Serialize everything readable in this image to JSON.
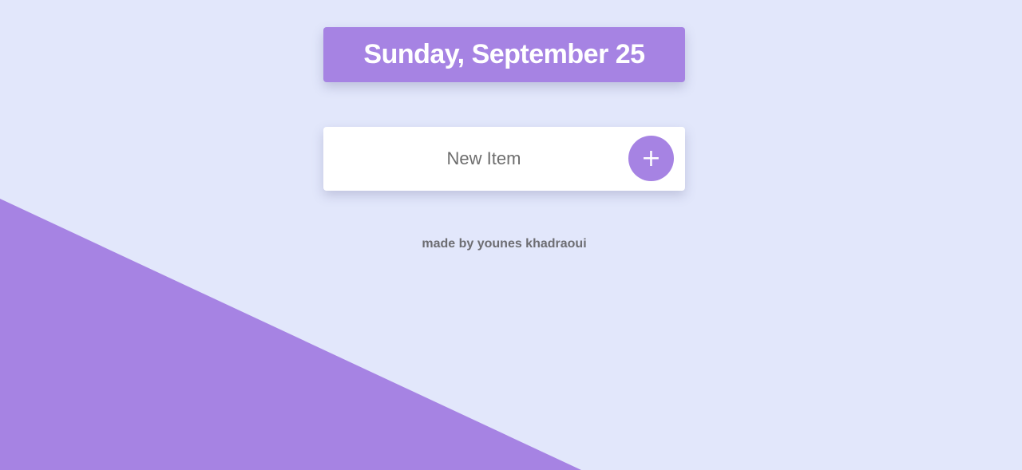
{
  "header": {
    "date": "Sunday, September 25"
  },
  "new_item": {
    "placeholder": "New Item",
    "add_button_label": "+"
  },
  "footer": {
    "credit": "made by younes khadraoui"
  },
  "colors": {
    "background": "#e2e7fb",
    "accent": "#a683e3",
    "card": "#ffffff",
    "muted_text": "#6d6d72"
  },
  "icons": {
    "add": "plus-icon"
  }
}
